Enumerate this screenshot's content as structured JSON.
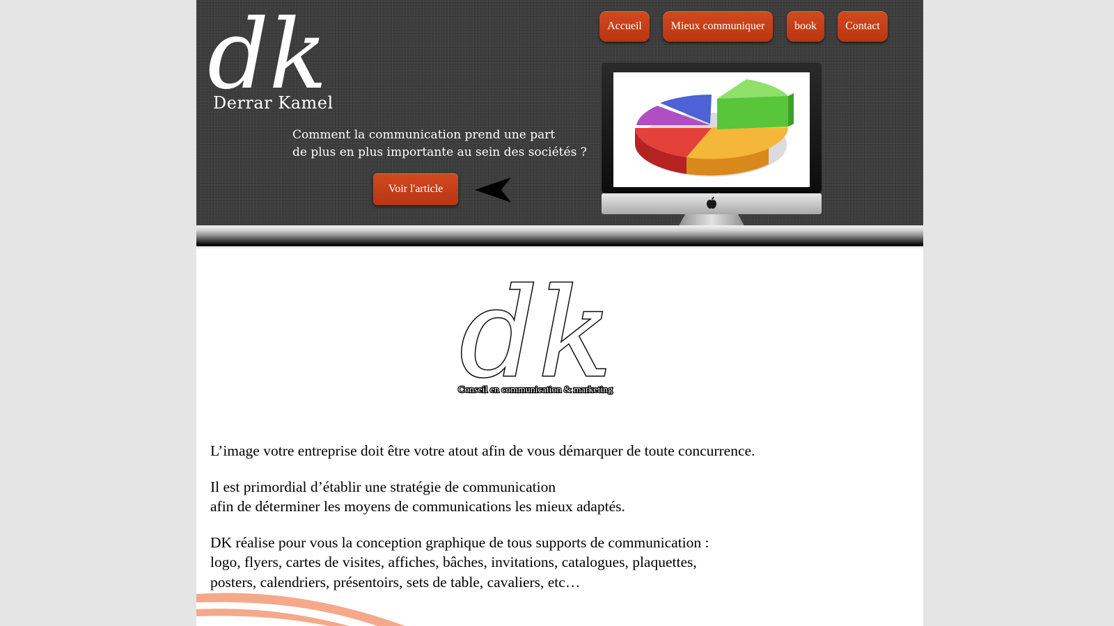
{
  "brand": {
    "monogram": "dk",
    "name": "Derrar Kamel"
  },
  "nav": [
    {
      "label": "Accueil"
    },
    {
      "label": "Mieux communiquer"
    },
    {
      "label": "book"
    },
    {
      "label": "Contact"
    }
  ],
  "hero": {
    "tagline_line1": "Comment la communication prend une part",
    "tagline_line2": "de plus en plus importante au sein des sociétés ?",
    "cta_label": "Voir l'article"
  },
  "center_logo": {
    "monogram": "dk",
    "subtitle": "Conseil en communication & marketing"
  },
  "content": {
    "paragraph1": "L’image votre entreprise doit être votre atout afin de vous démarquer de toute concurrence.",
    "paragraph2_line1": "Il est primordial d’établir une stratégie de communication",
    "paragraph2_line2": "afin de déterminer les moyens de communications les mieux adaptés.",
    "paragraph3_line1": "DK réalise pour vous la conception graphique de tous supports de communication :",
    "paragraph3_line2": "logo, flyers, cartes de visites, affiches, bâches, invitations, catalogues, plaquettes,",
    "paragraph3_line3": "posters, calendriers, présentoirs, sets de table, cavaliers, etc…"
  },
  "icons": [
    "apple-logo-icon",
    "arrow-left-icon",
    "pie-chart-illustration"
  ],
  "colors": {
    "header_bg": "#3d3d3d",
    "button_orange": "#c33f17",
    "page_bg": "#e5e5e5",
    "swoosh": "#f5a98a"
  }
}
